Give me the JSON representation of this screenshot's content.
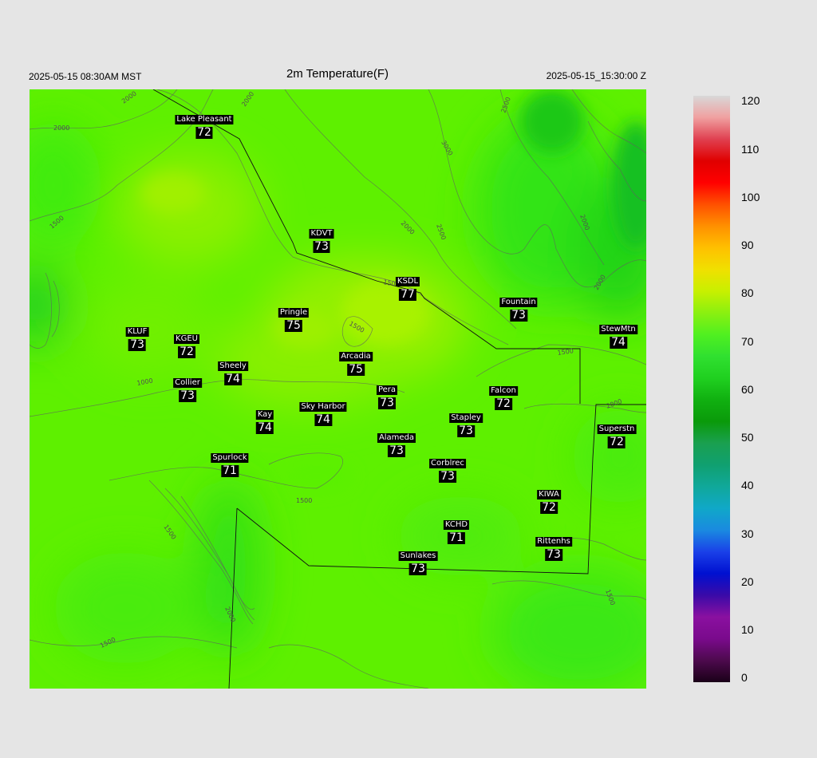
{
  "header": {
    "left_time": "2025-05-15 08:30AM MST",
    "title": "2m Temperature(F)",
    "right_time": "2025-05-15_15:30:00 Z"
  },
  "contour_labels": [
    "2000",
    "2000",
    "2000",
    "2500",
    "2000",
    "3000",
    "1500",
    "2000",
    "2500",
    "2000",
    "1500",
    "1500",
    "1000",
    "1500",
    "1500",
    "2000",
    "1500",
    "2000",
    "1500",
    "1500"
  ],
  "stations": [
    {
      "name": "Lake Pleasant",
      "temp": "72"
    },
    {
      "name": "KDVT",
      "temp": "73"
    },
    {
      "name": "KSDL",
      "temp": "77"
    },
    {
      "name": "Fountain",
      "temp": "73"
    },
    {
      "name": "StewMtn",
      "temp": "74"
    },
    {
      "name": "Pringle",
      "temp": "75"
    },
    {
      "name": "KLUF",
      "temp": "73"
    },
    {
      "name": "KGEU",
      "temp": "72"
    },
    {
      "name": "Arcadia",
      "temp": "75"
    },
    {
      "name": "Sheely",
      "temp": "74"
    },
    {
      "name": "Collier",
      "temp": "73"
    },
    {
      "name": "Pera",
      "temp": "73"
    },
    {
      "name": "Falcon",
      "temp": "72"
    },
    {
      "name": "Kay",
      "temp": "74"
    },
    {
      "name": "Sky Harbor",
      "temp": "74"
    },
    {
      "name": "Stapley",
      "temp": "73"
    },
    {
      "name": "Superstn",
      "temp": "72"
    },
    {
      "name": "Alameda",
      "temp": "73"
    },
    {
      "name": "Spurlock",
      "temp": "71"
    },
    {
      "name": "Corblrec",
      "temp": "73"
    },
    {
      "name": "KIWA",
      "temp": "72"
    },
    {
      "name": "KCHD",
      "temp": "71"
    },
    {
      "name": "Rittenhs",
      "temp": "73"
    },
    {
      "name": "Sunlakes",
      "temp": "73"
    }
  ],
  "colorbar": {
    "ticks": [
      "120",
      "110",
      "100",
      "90",
      "80",
      "70",
      "60",
      "50",
      "40",
      "30",
      "20",
      "10",
      "0"
    ],
    "colors": [
      "#1a0018",
      "#4d0a4d",
      "#7a0a8c",
      "#8a10a0",
      "#3a0aa8",
      "#0010d0",
      "#1a40e8",
      "#1a8ae0",
      "#10a8c8",
      "#10a89a",
      "#10a070",
      "#1aa050",
      "#0a9a0a",
      "#10b010",
      "#20d020",
      "#30e030",
      "#50f020",
      "#8af010",
      "#c8f000",
      "#f0e000",
      "#ffc000",
      "#ff9000",
      "#ff5000",
      "#ff0000",
      "#e00000",
      "#e04050",
      "#f0a0a0",
      "#d8d8d8"
    ]
  }
}
